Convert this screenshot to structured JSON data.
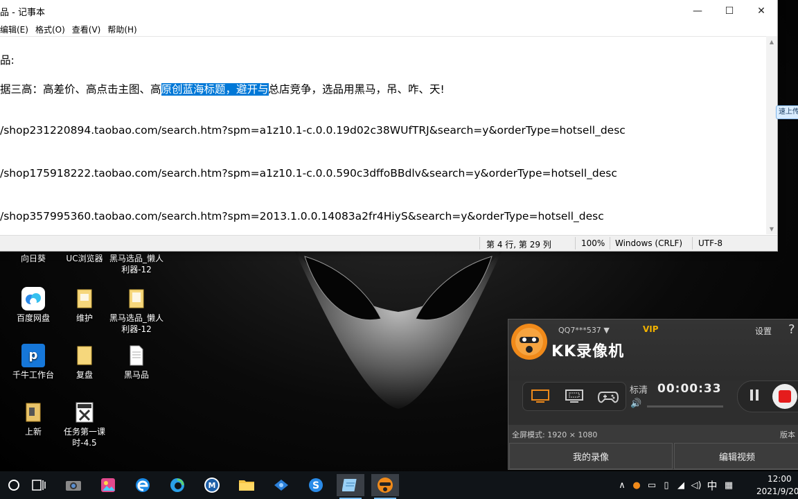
{
  "notepad": {
    "title": "品 - 记事本",
    "controls": {
      "minimize": "—",
      "maximize": "☐",
      "close": "✕"
    },
    "menu": [
      "编辑(E)",
      "格式(O)",
      "查看(V)",
      "帮助(H)"
    ],
    "lines": {
      "l1": "品:",
      "l2_pre": "据三高：高差价、高点击主图、高",
      "l2_sel": "原创蓝海标题，避开与",
      "l2_post": "总店竞争，选品用黑马，吊、咋、天!",
      "l3": "/shop231220894.taobao.com/search.htm?spm=a1z10.1-c.0.0.19d02c38WUfTRJ&search=y&orderType=hotsell_desc",
      "l4": "/shop175918222.taobao.com/search.htm?spm=a1z10.1-c.0.0.590c3dffoBBdlv&search=y&orderType=hotsell_desc",
      "l5": "/shop357995360.taobao.com/search.htm?spm=2013.1.0.0.14083a2fr4HiyS&search=y&orderType=hotsell_desc"
    },
    "status": {
      "pos": "第 4 行, 第 29 列",
      "zoom": "100%",
      "eol": "Windows (CRLF)",
      "enc": "UTF-8"
    }
  },
  "edge_pill": "速上传",
  "desktop_icons": {
    "i1": "向日葵",
    "i2": "UC浏览器",
    "i3": "黑马选品_懒人利器-12",
    "i4": "百度网盘",
    "i5": "维护",
    "i6": "黑马选品_懒人利器-12",
    "i7": "千牛工作台",
    "i8": "复盘",
    "i9": "黑马品",
    "i10": "上新",
    "i11": "任务第一课时-4.5"
  },
  "kk": {
    "user": "QQ7***537",
    "vip": "VIP",
    "settings": "设置",
    "help": "?",
    "brand": "KK录像机",
    "quality": "标清",
    "time": "00:00:33",
    "info": "全屏模式: 1920 × 1080",
    "version": "版本",
    "btn_my": "我的录像",
    "btn_edit": "编辑视频",
    "accent": "#f08a1a"
  },
  "taskbar": {
    "tray_ime": "中",
    "time": "12:00",
    "date": "2021/9/20"
  }
}
